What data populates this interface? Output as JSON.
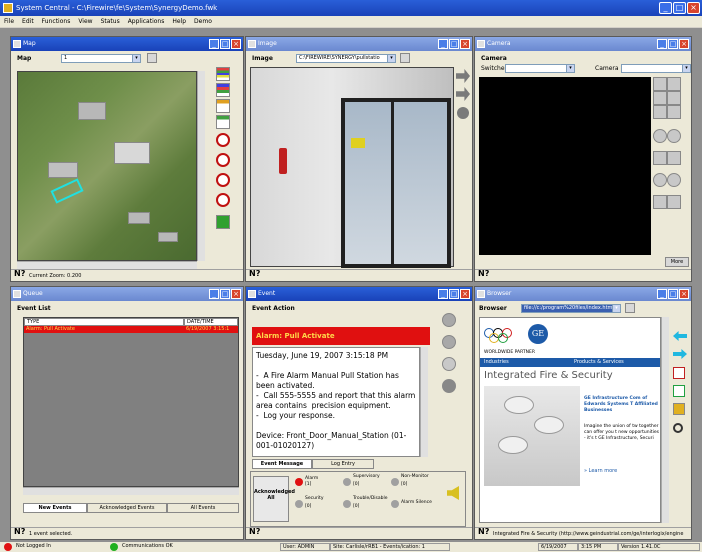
{
  "app": {
    "title": "System Central - C:\\Firewire\\fe\\System\\SynergyDemo.fwk"
  },
  "menu": [
    "File",
    "Edit",
    "Functions",
    "View",
    "Status",
    "Applications",
    "Help",
    "Demo"
  ],
  "map": {
    "title": "Map",
    "label": "Map",
    "select": "1",
    "status": "Current Zoom: 0.200"
  },
  "image": {
    "title": "Image",
    "label": "Image",
    "path": "C:\\FIREWIRE\\SYNERGY\\pullstatio"
  },
  "camera": {
    "title": "Camera",
    "section": "Camera",
    "switcher_label": "Switcher",
    "camera_label": "Camera",
    "more": "More"
  },
  "queue": {
    "title": "Queue",
    "section": "Event List",
    "columns": [
      "TYPE",
      "DATE/TIME"
    ],
    "rows": [
      {
        "type": "Alarm: Pull Activate",
        "datetime": "6/19/2007 3:15:1"
      }
    ],
    "tabs": [
      "New Events",
      "Acknowledged Events",
      "All Events"
    ],
    "status": "1 event selected."
  },
  "event": {
    "title": "Event",
    "section": "Event Action",
    "alarm": "Alarm: Pull Activate",
    "body": "Tuesday, June 19, 2007 3:15:18 PM\n\n-  A Fire Alarm Manual Pull Station has been activated.\n-  Call 555-5555 and report that this alarm area contains  precision equipment.\n-  Log your response.\n\nDevice: Front_Door_Manual_Station (01-001-01020127)",
    "tabs": [
      "Event Message",
      "Log Entry"
    ],
    "ack": "Acknowledged\nAll",
    "indicators": [
      {
        "name": "Alarm",
        "count": "[1]",
        "color": "#e01010"
      },
      {
        "name": "Supervisory",
        "count": "[0]",
        "color": "#a0a0a0"
      },
      {
        "name": "Non-Monitor",
        "count": "[0]",
        "color": "#a0a0a0"
      },
      {
        "name": "Security",
        "count": "[0]",
        "color": "#a0a0a0"
      },
      {
        "name": "Trouble/Disable",
        "count": "[0]",
        "color": "#a0a0a0"
      },
      {
        "name": "Alarm Silence",
        "count": "",
        "color": "#a0a0a0"
      }
    ]
  },
  "browser": {
    "title": "Browser",
    "label": "Browser",
    "url": "file://c:/program%20files/index.htm",
    "worldwide": "WORLDWIDE PARTNER",
    "nav": [
      "Industries",
      "Products & Services"
    ],
    "headline": "Integrated Fire & Security",
    "link": "GE Infrastructure Com of Edwards Systems T Affiliated Businesses",
    "para": "Imagine the union of tw together can offer you t new opportunities -- it's t GE Infrastructure, Securi",
    "learn": "» Learn more",
    "status": "Integrated Fire & Security (http://www.geindustrial.com/ge/interlogix/engine"
  },
  "statusbar": {
    "conn": "Not Logged In",
    "connection": "Communications OK",
    "user": "User: ADMIN",
    "site": "Site: Carlisle/rRB1 - Events/ication: 1",
    "date": "6/19/2007",
    "time": "3:15 PM",
    "version": "Version 1.41.0C"
  },
  "colors": {
    "title_active": "#1942b8",
    "alarm_red": "#e01010",
    "ge_blue": "#1d5aa8"
  }
}
